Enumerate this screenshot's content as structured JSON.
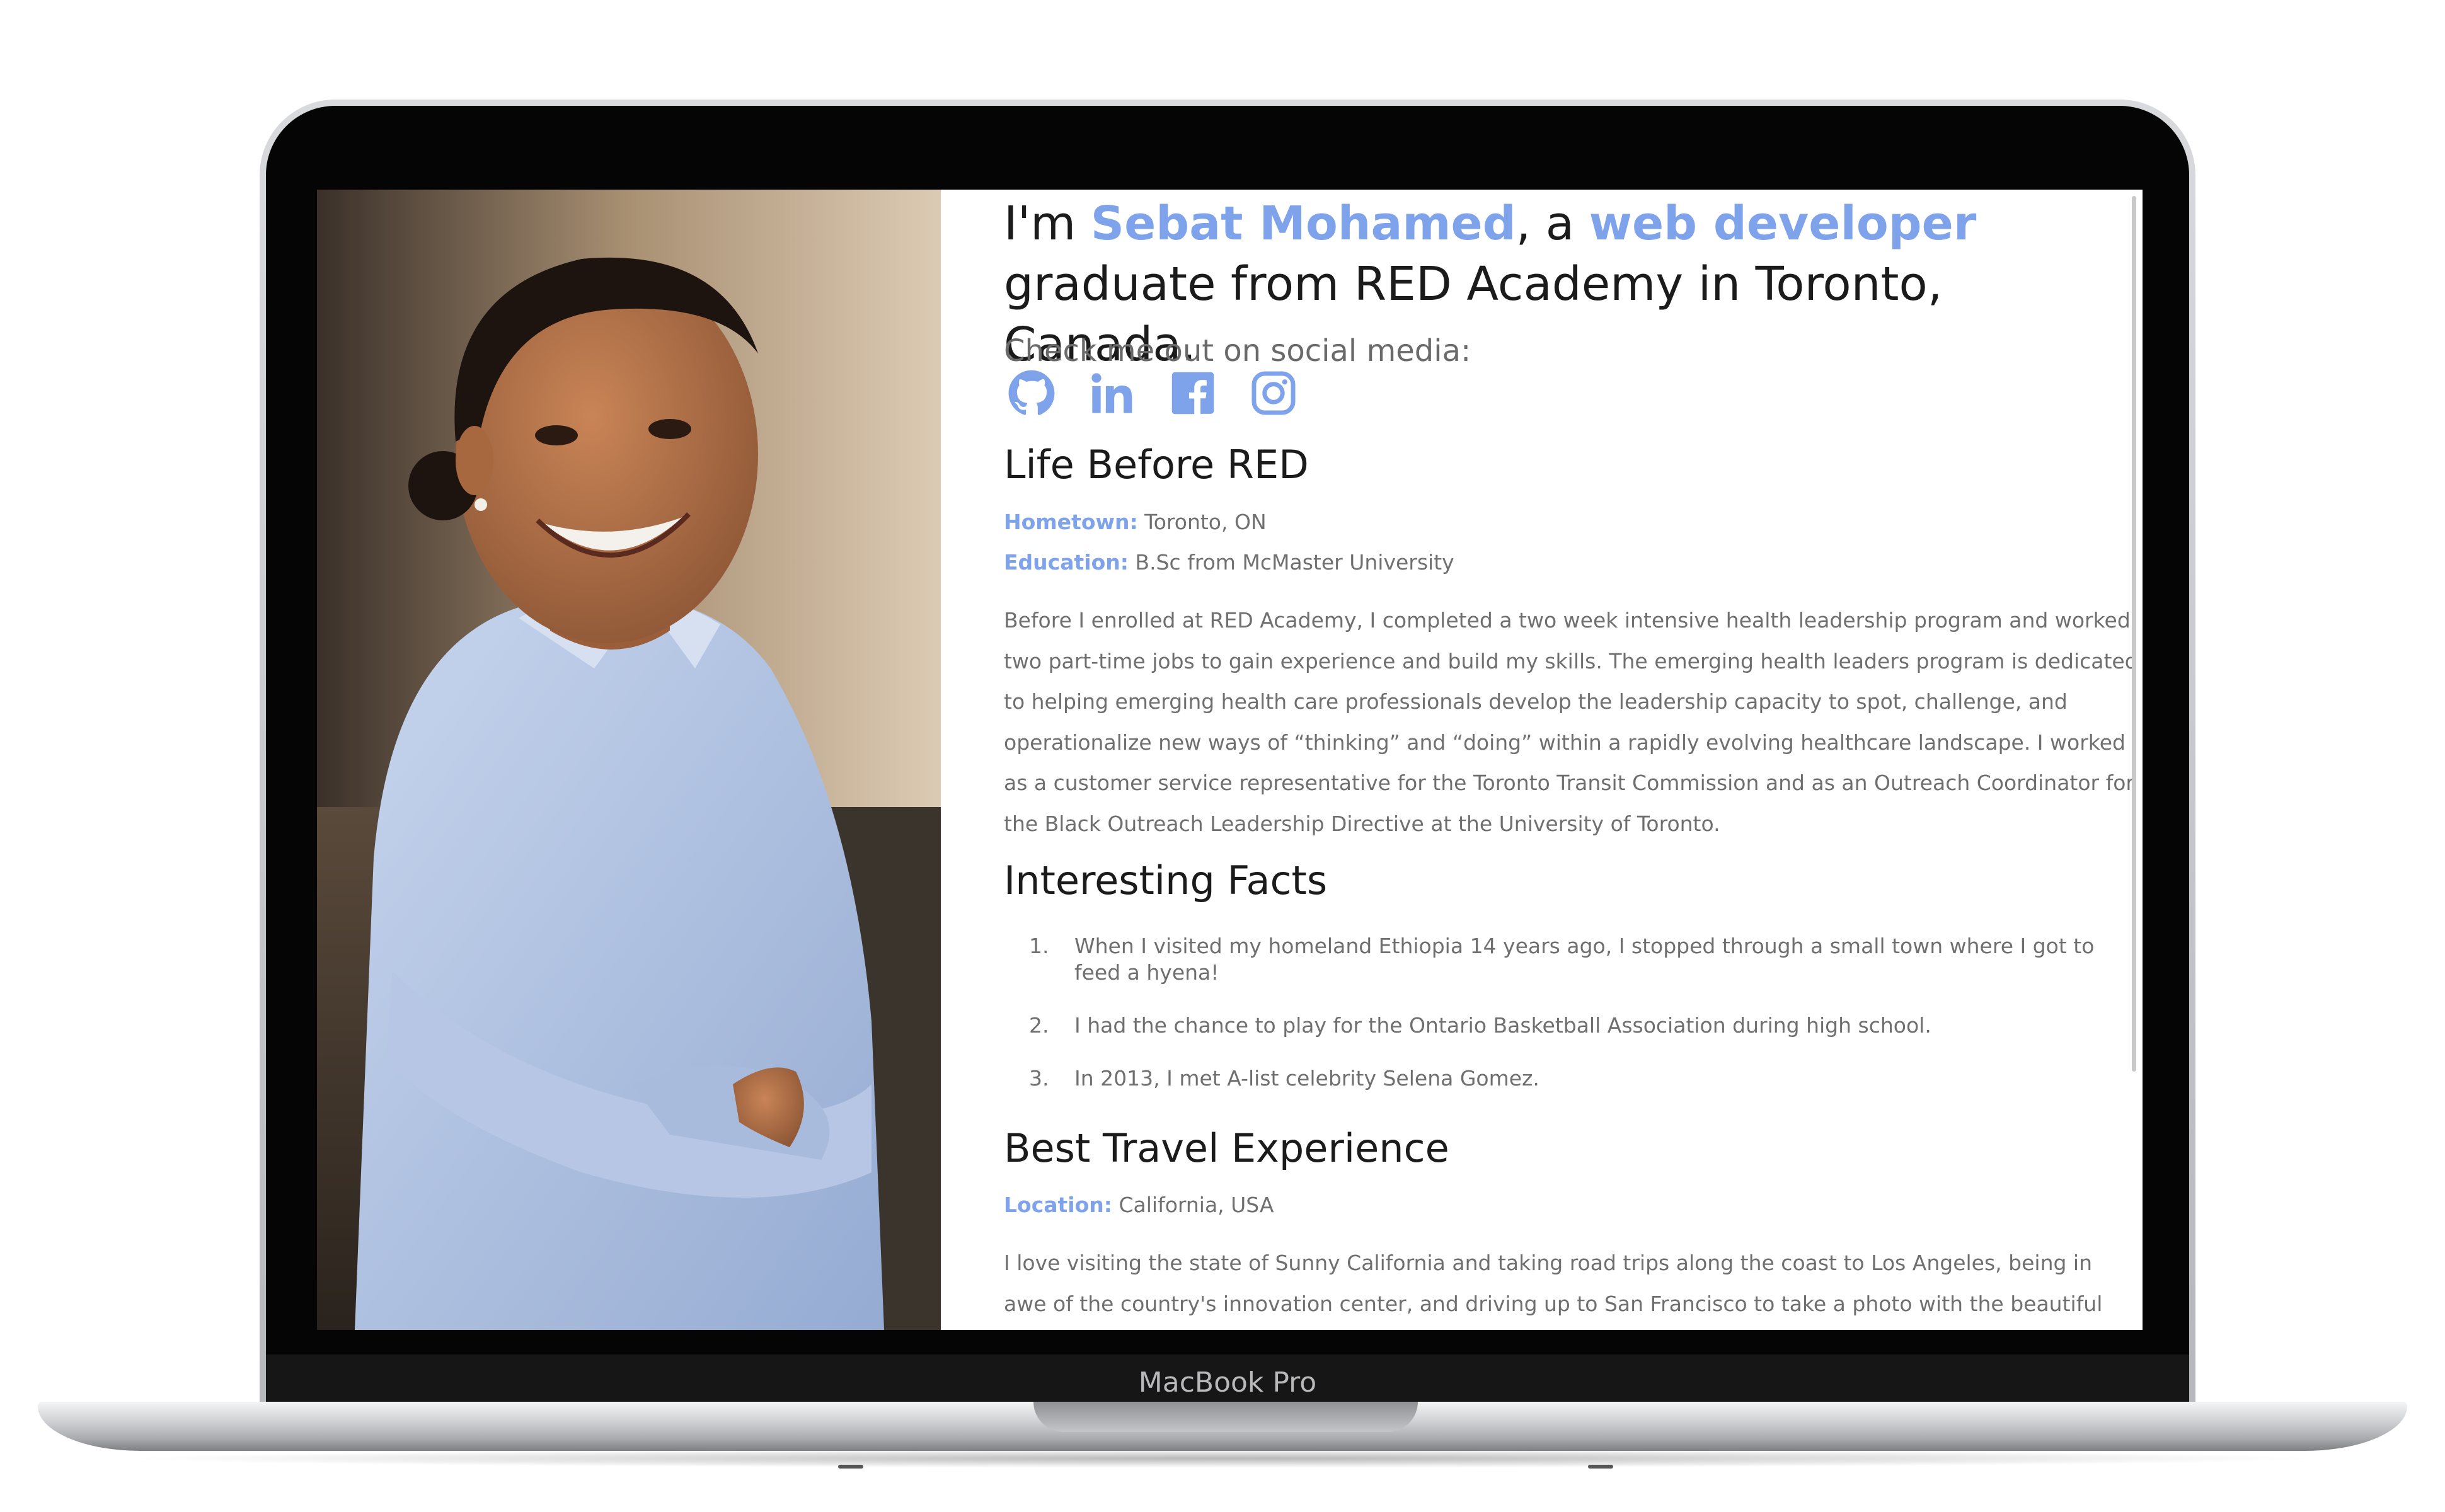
{
  "device": {
    "brand_label": "MacBook Pro"
  },
  "profile": {
    "intro_prefix": "I'm ",
    "name": "Sebat Mohamed",
    "intro_mid": ", a ",
    "role": "web developer",
    "intro_suffix": " graduate from RED Academy in Toronto, Canada."
  },
  "social": {
    "caption": "Check me out on social media:",
    "links": [
      {
        "icon": "github-icon"
      },
      {
        "icon": "linkedin-icon"
      },
      {
        "icon": "facebook-icon"
      },
      {
        "icon": "instagram-icon"
      }
    ]
  },
  "life_before": {
    "heading": "Life Before RED",
    "hometown_label": "Hometown:",
    "hometown_value": " Toronto, ON",
    "education_label": "Education:",
    "education_value": " B.Sc from McMaster University",
    "paragraph": "Before I enrolled at RED Academy, I completed a two week intensive health leadership program and worked two part-time jobs to gain experience and build my skills. The emerging health leaders program is dedicated to helping emerging health care professionals develop the leadership capacity to spot, challenge, and operationalize new ways of “thinking” and “doing” within a rapidly evolving healthcare landscape. I worked as a customer service representative for the Toronto Transit Commission and as an Outreach Coordinator for the Black Outreach Leadership Directive at the University of Toronto."
  },
  "facts": {
    "heading": "Interesting Facts",
    "items": [
      {
        "num": "1.",
        "text": "When I visited my homeland Ethiopia 14 years ago, I stopped through a small town where I got to feed a hyena!"
      },
      {
        "num": "2.",
        "text": "I had the chance to play for the Ontario Basketball Association during high school."
      },
      {
        "num": "3.",
        "text": "In 2013, I met A-list celebrity Selena Gomez."
      }
    ]
  },
  "travel": {
    "heading": "Best Travel Experience",
    "location_label": "Location:",
    "location_value": " California, USA",
    "paragraph": "I love visiting the state of Sunny California and taking road trips along the coast to Los Angeles, being in awe of the country's innovation center, and driving up to San Francisco to take a photo with the beautiful Golden Gate Bridge. I"
  },
  "colors": {
    "accent": "#7fa3ea",
    "text": "#1b1b1b",
    "muted": "#6f6f6f"
  }
}
